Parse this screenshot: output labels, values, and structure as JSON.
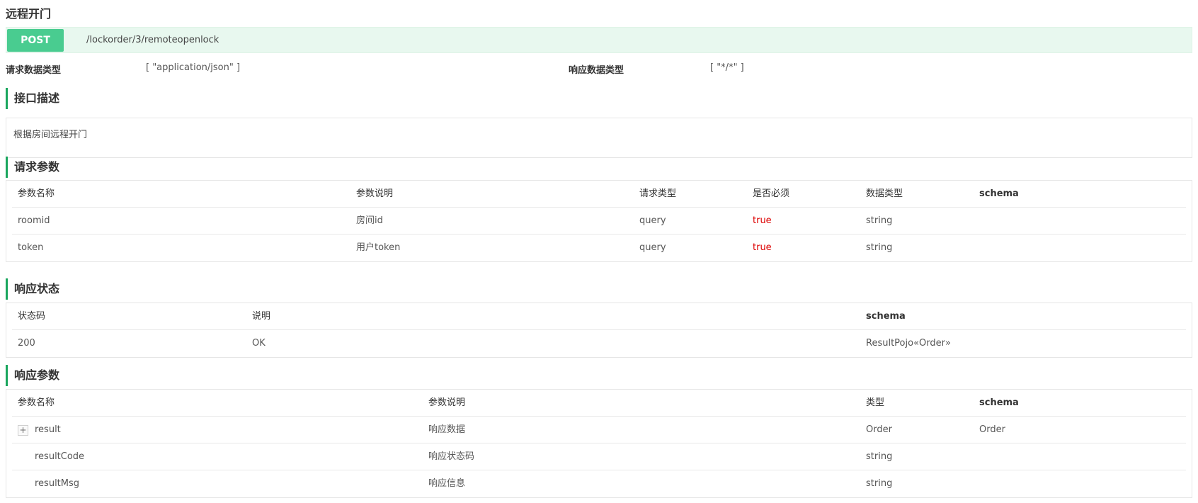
{
  "operation": {
    "title": "远程开门",
    "method": "POST",
    "path": "/lockorder/3/remoteopenlock"
  },
  "content_types": {
    "request_label": "请求数据类型",
    "request_value": "[ \"application/json\" ]",
    "response_label": "响应数据类型",
    "response_value": "[ \"*/*\" ]"
  },
  "description": {
    "title": "接口描述",
    "text": "根据房间远程开门"
  },
  "request_params": {
    "title": "请求参数",
    "headers": [
      "参数名称",
      "参数说明",
      "请求类型",
      "是否必须",
      "数据类型",
      "schema"
    ],
    "rows": [
      [
        "roomid",
        "房间id",
        "query",
        "true",
        "string",
        ""
      ],
      [
        "token",
        "用户token",
        "query",
        "true",
        "string",
        ""
      ]
    ]
  },
  "response_status": {
    "title": "响应状态",
    "headers": [
      "状态码",
      "说明",
      "schema"
    ],
    "rows": [
      [
        "200",
        "OK",
        "ResultPojo«Order»"
      ]
    ]
  },
  "response_params": {
    "title": "响应参数",
    "headers": [
      "参数名称",
      "参数说明",
      "类型",
      "schema"
    ],
    "expand_symbol": "+",
    "rows": [
      [
        "result",
        "响应数据",
        "Order",
        "Order"
      ],
      [
        "resultCode",
        "响应状态码",
        "string",
        ""
      ],
      [
        "resultMsg",
        "响应信息",
        "string",
        ""
      ]
    ]
  },
  "colors": {
    "post": "#49cc90",
    "post_bg": "#e8f8ef",
    "accent": "#1aa65e",
    "required": "#dd0000"
  }
}
